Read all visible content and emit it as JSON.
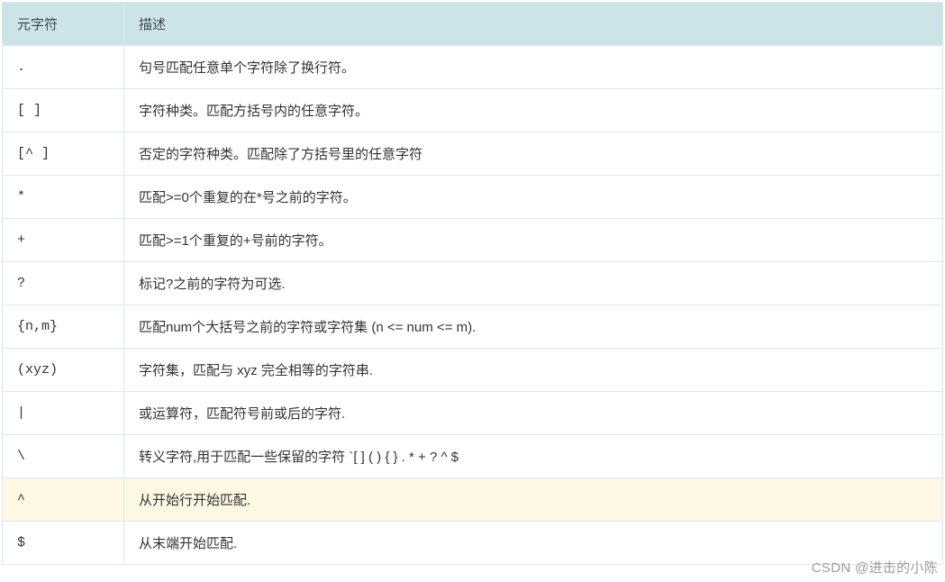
{
  "table": {
    "headers": {
      "char": "元字符",
      "desc": "描述"
    },
    "rows": [
      {
        "char": ".",
        "desc": "句号匹配任意单个字符除了换行符。",
        "highlight": false
      },
      {
        "char": "[ ]",
        "desc": "字符种类。匹配方括号内的任意字符。",
        "highlight": false
      },
      {
        "char": "[^ ]",
        "desc": "否定的字符种类。匹配除了方括号里的任意字符",
        "highlight": false
      },
      {
        "char": "*",
        "desc": "匹配>=0个重复的在*号之前的字符。",
        "highlight": false
      },
      {
        "char": "+",
        "desc": "匹配>=1个重复的+号前的字符。",
        "highlight": false
      },
      {
        "char": "?",
        "desc": "标记?之前的字符为可选.",
        "highlight": false
      },
      {
        "char": "{n,m}",
        "desc": "匹配num个大括号之前的字符或字符集 (n <= num <= m).",
        "highlight": false
      },
      {
        "char": "(xyz)",
        "desc": "字符集，匹配与 xyz 完全相等的字符串.",
        "highlight": false
      },
      {
        "char": "|",
        "desc": "或运算符，匹配符号前或后的字符.",
        "highlight": false
      },
      {
        "char": "\\",
        "desc": "转义字符,用于匹配一些保留的字符 `[ ] ( ) { } . * + ? ^ $",
        "highlight": false
      },
      {
        "char": "^",
        "desc": "从开始行开始匹配.",
        "highlight": true
      },
      {
        "char": "$",
        "desc": "从末端开始匹配.",
        "highlight": false
      }
    ]
  },
  "watermark": "CSDN @进击的小陈"
}
